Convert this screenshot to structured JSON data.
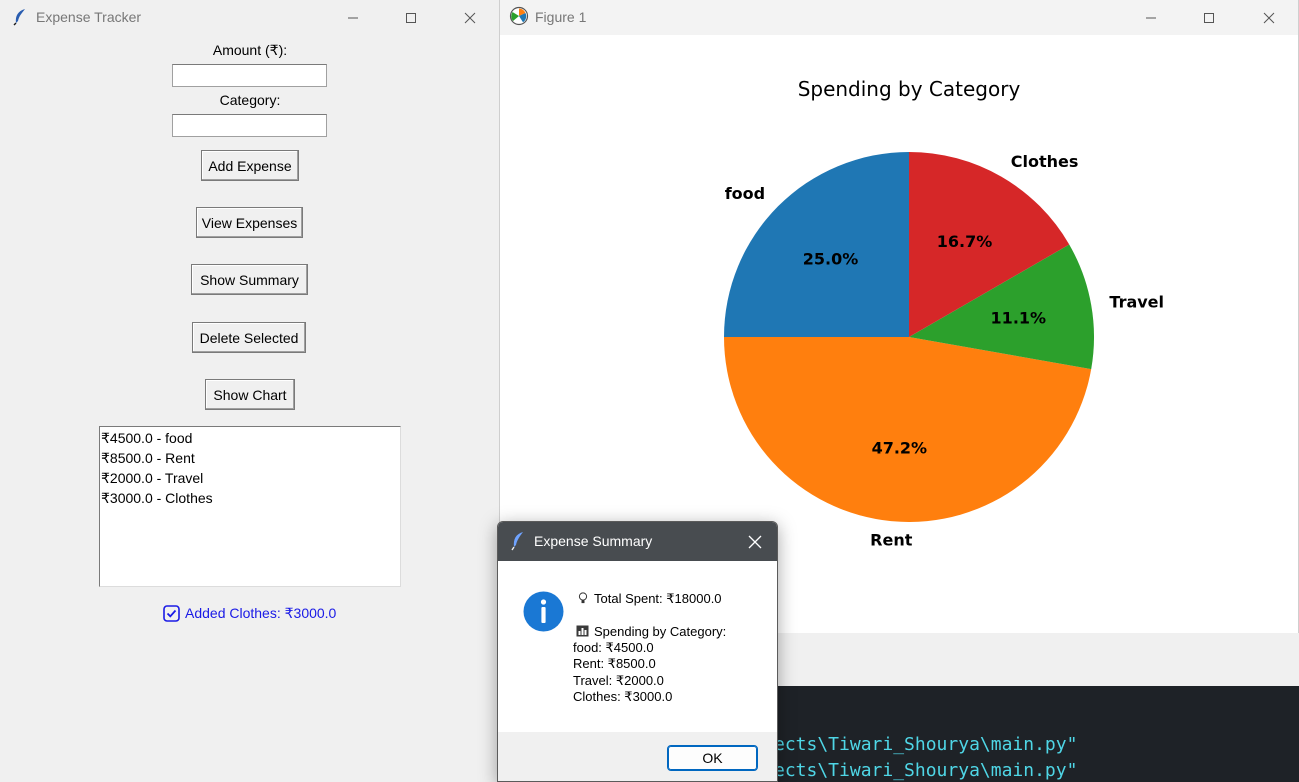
{
  "terminal": {
    "lines": [
      "ects\\Tiwari_Shourya\\main.py\"",
      "ects\\Tiwari_Shourya\\main.py\""
    ]
  },
  "tracker": {
    "title": "Expense Tracker",
    "amount_label": "Amount (₹):",
    "amount_value": "",
    "category_label": "Category:",
    "category_value": "",
    "buttons": {
      "add": "Add Expense",
      "view": "View Expenses",
      "summary": "Show Summary",
      "delete": "Delete Selected",
      "chart": "Show Chart"
    },
    "expenses": [
      "₹4500.0 - food",
      "₹8500.0 - Rent",
      "₹2000.0 - Travel",
      "₹3000.0 - Clothes"
    ],
    "status_text": "Added Clothes: ₹3000.0",
    "status_color": "#1a1ae6"
  },
  "figure": {
    "title": "Figure 1"
  },
  "chart_data": {
    "type": "pie",
    "title": "Spending by Category",
    "categories": [
      "food",
      "Rent",
      "Travel",
      "Clothes"
    ],
    "values": [
      4500,
      8500,
      2000,
      3000
    ],
    "percent_labels": [
      "25.0%",
      "47.2%",
      "11.1%",
      "16.7%"
    ],
    "colors": [
      "#1f77b4",
      "#ff7f0e",
      "#2ca02c",
      "#d62728"
    ],
    "start_angle_deg": 90,
    "direction": "counterclockwise",
    "legend": "none"
  },
  "dialog": {
    "title": "Expense Summary",
    "total_line": "Total Spent: ₹18000.0",
    "category_header": "Spending by Category:",
    "lines": [
      "food: ₹4500.0",
      "Rent: ₹8500.0",
      "Travel: ₹2000.0",
      "Clothes: ₹3000.0"
    ],
    "ok_label": "OK"
  }
}
